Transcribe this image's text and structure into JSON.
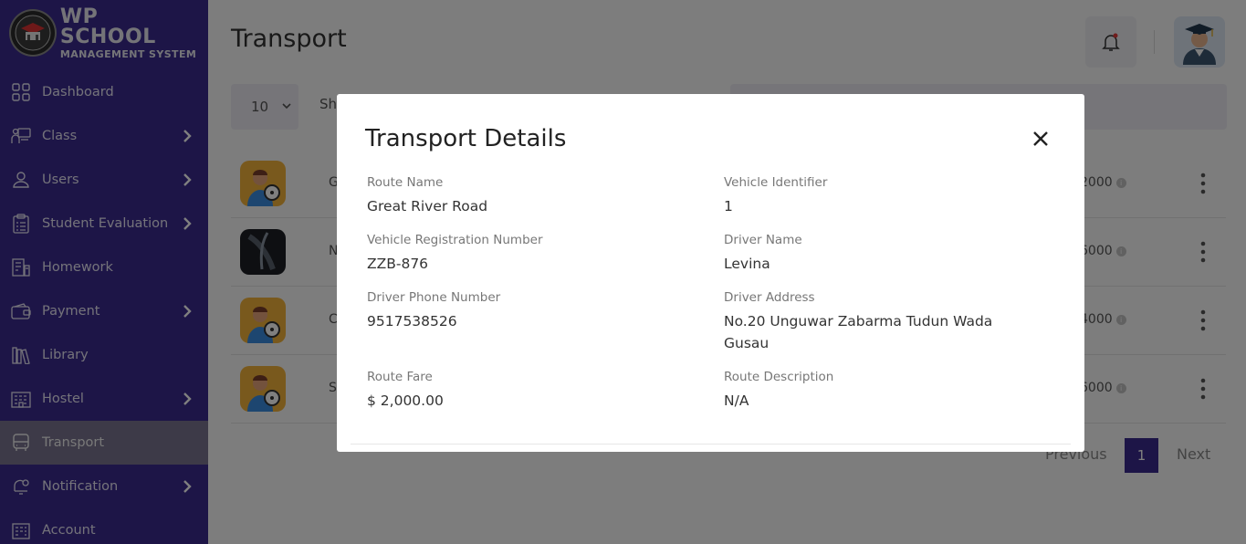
{
  "brand": {
    "title": "WP SCHOOL",
    "subtitle": "MANAGEMENT SYSTEM"
  },
  "sidebar": {
    "items": [
      {
        "label": "Dashboard",
        "icon": "dashboard-icon",
        "has_submenu": false
      },
      {
        "label": "Class",
        "icon": "class-icon",
        "has_submenu": true
      },
      {
        "label": "Users",
        "icon": "user-icon",
        "has_submenu": true
      },
      {
        "label": "Student Evaluation",
        "icon": "clipboard-icon",
        "has_submenu": true
      },
      {
        "label": "Homework",
        "icon": "homework-icon",
        "has_submenu": false
      },
      {
        "label": "Payment",
        "icon": "wallet-icon",
        "has_submenu": true
      },
      {
        "label": "Library",
        "icon": "library-icon",
        "has_submenu": false
      },
      {
        "label": "Hostel",
        "icon": "hostel-icon",
        "has_submenu": true
      },
      {
        "label": "Transport",
        "icon": "bus-icon",
        "has_submenu": false,
        "active": true
      },
      {
        "label": "Notification",
        "icon": "notification-icon",
        "has_submenu": true
      },
      {
        "label": "Account",
        "icon": "account-icon",
        "has_submenu": false
      }
    ]
  },
  "header": {
    "title": "Transport"
  },
  "table_controls": {
    "entries_value": "10",
    "show_label": "Sh"
  },
  "table": {
    "rows": [
      {
        "cut_text": "G",
        "fare": "2000",
        "thumb": "driver-avatar"
      },
      {
        "cut_text": "N",
        "fare": "6000",
        "thumb": "photo"
      },
      {
        "cut_text": "C",
        "fare": "4000",
        "thumb": "driver-avatar"
      },
      {
        "cut_text": "S",
        "fare": "6000",
        "thumb": "driver-avatar"
      }
    ]
  },
  "pagination": {
    "previous": "Previous",
    "page": "1",
    "next": "Next"
  },
  "modal": {
    "title": "Transport Details",
    "fields": {
      "route_name": {
        "label": "Route Name",
        "value": "Great River Road"
      },
      "vehicle_identifier": {
        "label": "Vehicle Identifier",
        "value": "1"
      },
      "vehicle_reg": {
        "label": "Vehicle Registration Number",
        "value": "ZZB-876"
      },
      "driver_name": {
        "label": "Driver Name",
        "value": "Levina"
      },
      "driver_phone": {
        "label": "Driver Phone Number",
        "value": "9517538526"
      },
      "driver_address": {
        "label": "Driver Address",
        "value": "No.20 Unguwar Zabarma Tudun Wada Gusau"
      },
      "route_fare": {
        "label": "Route Fare",
        "value": "$ 2,000.00"
      },
      "route_description": {
        "label": "Route Description",
        "value": "N/A"
      }
    }
  },
  "colors": {
    "sidebar": "#3b2a8f",
    "active_item": "#7a7590",
    "accent": "#3b2a8f"
  }
}
